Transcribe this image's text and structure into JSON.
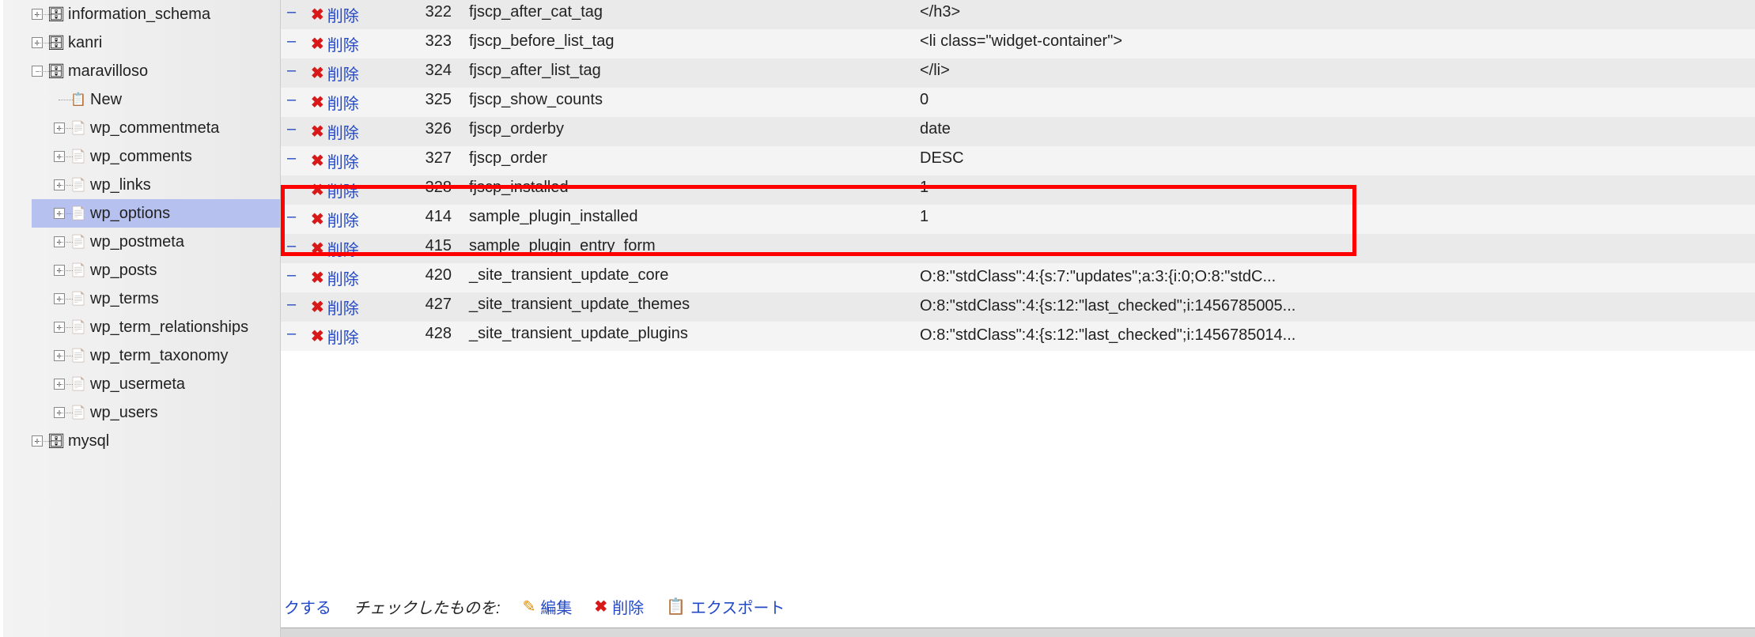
{
  "sidebar": {
    "items": [
      {
        "expander": "+",
        "icon": "db",
        "label": "information_schema",
        "indent": 1
      },
      {
        "expander": "+",
        "icon": "db",
        "label": "kanri",
        "indent": 1
      },
      {
        "expander": "-",
        "icon": "db",
        "label": "maravilloso",
        "indent": 1
      },
      {
        "expander": "",
        "icon": "new",
        "label": "New",
        "indent": 2
      },
      {
        "expander": "+",
        "icon": "tbl",
        "label": "wp_commentmeta",
        "indent": 2
      },
      {
        "expander": "+",
        "icon": "tbl",
        "label": "wp_comments",
        "indent": 2
      },
      {
        "expander": "+",
        "icon": "tbl",
        "label": "wp_links",
        "indent": 2
      },
      {
        "expander": "+",
        "icon": "tbl",
        "label": "wp_options",
        "indent": 2,
        "selected": true
      },
      {
        "expander": "+",
        "icon": "tbl",
        "label": "wp_postmeta",
        "indent": 2
      },
      {
        "expander": "+",
        "icon": "tbl",
        "label": "wp_posts",
        "indent": 2
      },
      {
        "expander": "+",
        "icon": "tbl",
        "label": "wp_terms",
        "indent": 2
      },
      {
        "expander": "+",
        "icon": "tbl",
        "label": "wp_term_relationships",
        "indent": 2
      },
      {
        "expander": "+",
        "icon": "tbl",
        "label": "wp_term_taxonomy",
        "indent": 2
      },
      {
        "expander": "+",
        "icon": "tbl",
        "label": "wp_usermeta",
        "indent": 2
      },
      {
        "expander": "+",
        "icon": "tbl",
        "label": "wp_users",
        "indent": 2
      },
      {
        "expander": "+",
        "icon": "db",
        "label": "mysql",
        "indent": 1
      }
    ]
  },
  "table": {
    "delete_label": "削除",
    "rows": [
      {
        "id": "322",
        "name": "fjscp_after_cat_tag",
        "value": "</h3>"
      },
      {
        "id": "323",
        "name": "fjscp_before_list_tag",
        "value": "<li class=\"widget-container\">"
      },
      {
        "id": "324",
        "name": "fjscp_after_list_tag",
        "value": "</li>"
      },
      {
        "id": "325",
        "name": "fjscp_show_counts",
        "value": "0"
      },
      {
        "id": "326",
        "name": "fjscp_orderby",
        "value": "date"
      },
      {
        "id": "327",
        "name": "fjscp_order",
        "value": "DESC"
      },
      {
        "id": "328",
        "name": "fjscp_installed",
        "value": "1"
      },
      {
        "id": "414",
        "name": "sample_plugin_installed",
        "value": "1"
      },
      {
        "id": "415",
        "name": "sample_plugin_entry_form",
        "value": ""
      },
      {
        "id": "420",
        "name": "_site_transient_update_core",
        "value": "O:8:\"stdClass\":4:{s:7:\"updates\";a:3:{i:0;O:8:\"stdC...",
        "wrap": true
      },
      {
        "id": "427",
        "name": "_site_transient_update_themes",
        "value": "O:8:\"stdClass\":4:{s:12:\"last_checked\";i:1456785005...",
        "wrap": true
      },
      {
        "id": "428",
        "name": "_site_transient_update_plugins",
        "value": "O:8:\"stdClass\":4:{s:12:\"last_checked\";i:1456785014...",
        "wrap": true
      }
    ]
  },
  "actions": {
    "check_partial": "クする",
    "with_selected": "チェックしたものを:",
    "edit": "編集",
    "delete": "削除",
    "export": "エクスポート"
  }
}
